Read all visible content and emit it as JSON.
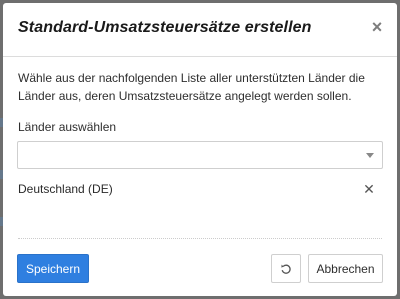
{
  "modal": {
    "title": "Standard-Umsatzsteuersätze erstellen",
    "close_glyph": "×",
    "description": "Wähle aus der nachfolgenden Liste aller unterstützten Länder die Länder aus, deren Umsatzsteuersätze angelegt werden sollen.",
    "country_select": {
      "label": "Länder auswählen",
      "value": ""
    },
    "selected_countries": [
      {
        "label": "Deutschland (DE)",
        "remove_glyph": "✕"
      }
    ],
    "footer": {
      "save_label": "Speichern",
      "reset_icon": "undo-icon",
      "cancel_label": "Abbrechen"
    }
  },
  "colors": {
    "primary": "#2f7fe0",
    "overlay": "#6e6e6e"
  }
}
